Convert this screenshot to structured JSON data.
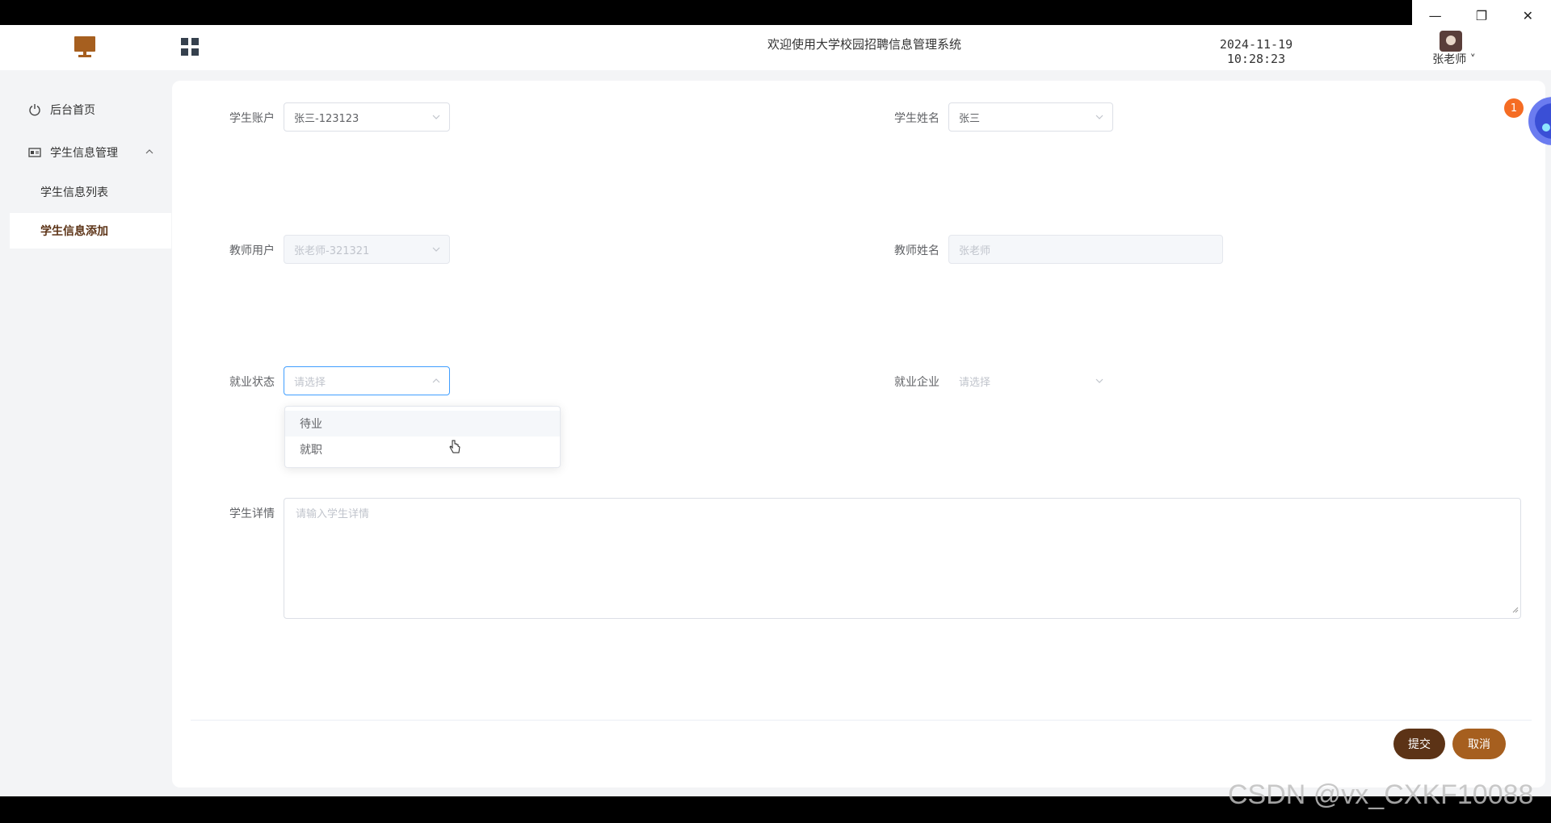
{
  "window": {
    "minimize_glyph": "—",
    "restore_glyph": "❐",
    "close_glyph": "✕"
  },
  "header": {
    "system_title": "欢迎使用大学校园招聘信息管理系统",
    "datetime": "2024-11-19 10:28:23",
    "username": "张老师 ˅",
    "logo_icon": "monitor-icon",
    "menu_toggle_icon": "grid-icon"
  },
  "sidebar": {
    "items": [
      {
        "label": "后台首页",
        "icon": "power-icon"
      },
      {
        "label": "学生信息管理",
        "icon": "id-card-icon"
      },
      {
        "label": "学生信息列表"
      },
      {
        "label": "学生信息添加"
      }
    ]
  },
  "form": {
    "student_account": {
      "label": "学生账户",
      "value": "张三-123123"
    },
    "student_name": {
      "label": "学生姓名",
      "value": "张三"
    },
    "teacher_account": {
      "label": "教师用户",
      "value": "张老师-321321"
    },
    "teacher_name": {
      "label": "教师姓名",
      "value": "张老师"
    },
    "employment_status": {
      "label": "就业状态",
      "placeholder": "请选择"
    },
    "employer": {
      "label": "就业企业",
      "placeholder": "请选择"
    },
    "student_detail": {
      "label": "学生详情",
      "placeholder": "请输入学生详情"
    }
  },
  "dropdown": {
    "options": [
      "待业",
      "就职"
    ]
  },
  "actions": {
    "submit": "提交",
    "cancel": "取消"
  },
  "notification": {
    "badge_count": "1"
  },
  "watermark": "CSDN @vx_CXKF10088",
  "colors": {
    "primary_dark": "#5c3316",
    "primary_brown": "#a65f1f",
    "focus_blue": "#409eff",
    "badge_orange": "#f56c23"
  }
}
